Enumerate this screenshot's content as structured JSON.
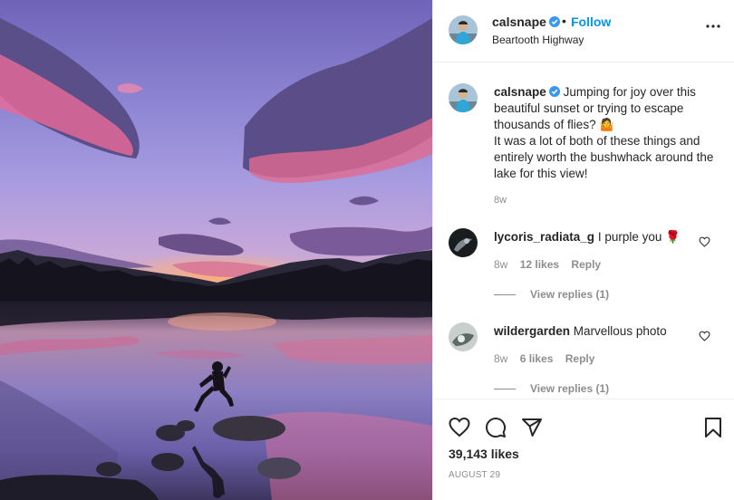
{
  "post": {
    "photo_alt": "Person jumping between rocks on a lake at sunset",
    "header": {
      "username": "calsnape",
      "separator": "•",
      "follow_label": "Follow",
      "location": "Beartooth Highway",
      "more_icon": "more-horizontal-icon"
    },
    "caption": {
      "username": "calsnape",
      "line1": "Jumping for joy over this beautiful sunset or trying to escape thousands of flies? 🤷",
      "line2": "It was a lot of both of these things and entirely worth the bushwhack around the lake for this view!",
      "time": "8w"
    },
    "comments": [
      {
        "username": "lycoris_radiata_g",
        "text": "I purple you 🌹",
        "time": "8w",
        "likes": "12 likes",
        "reply_label": "Reply",
        "view_replies": "View replies (1)"
      },
      {
        "username": "wildergarden",
        "text": "Marvellous photo",
        "time": "8w",
        "likes": "6 likes",
        "reply_label": "Reply",
        "view_replies": "View replies (1)"
      }
    ],
    "actions": {
      "like_icon": "heart-icon",
      "comment_icon": "comment-icon",
      "share_icon": "share-icon",
      "save_icon": "bookmark-icon"
    },
    "likes_count": "39,143 likes",
    "date": "AUGUST 29"
  },
  "colors": {
    "link": "#0095f6",
    "verified": "#3897f0",
    "text": "#262626",
    "muted": "#8e8e8e",
    "border": "#efefef"
  }
}
